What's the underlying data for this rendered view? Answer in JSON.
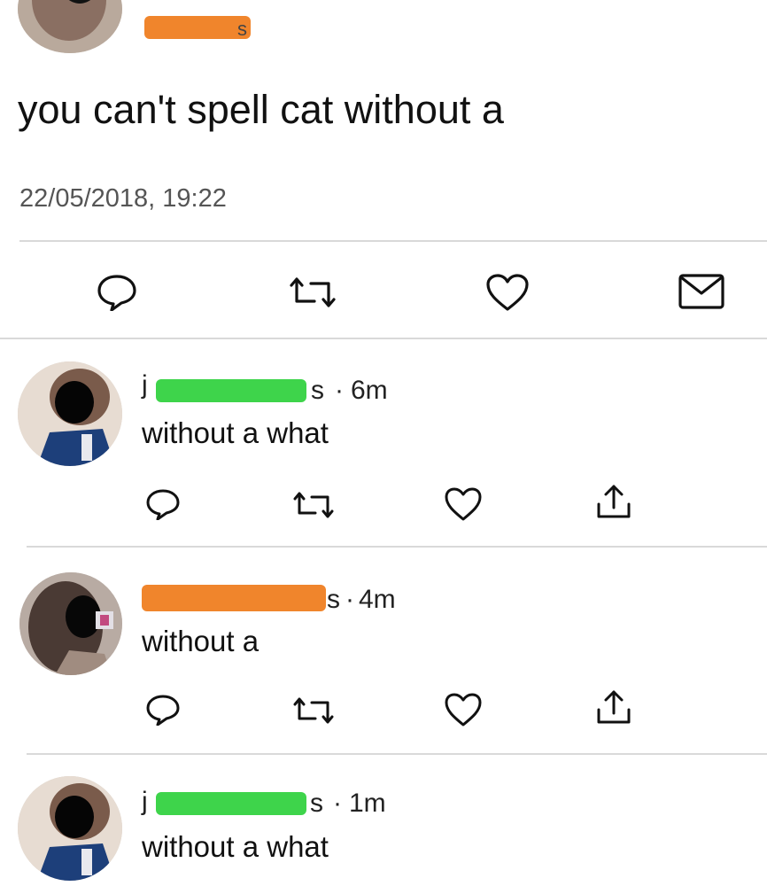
{
  "main_tweet": {
    "text": "you can't spell cat without a",
    "timestamp": "22/05/2018, 19:22",
    "handle_suffix": "s"
  },
  "action_icons": {
    "main": [
      "reply-icon",
      "retweet-icon",
      "like-icon",
      "direct-message-icon"
    ],
    "reply": [
      "reply-icon",
      "retweet-icon",
      "like-icon",
      "share-icon"
    ]
  },
  "replies": [
    {
      "name_prefix": "j",
      "name_suffix": "s",
      "separator": "·",
      "time": "6m",
      "text": "without a what",
      "redaction_color": "#3ed44b"
    },
    {
      "name_suffix": "s",
      "separator": "·",
      "time": "4m",
      "text": "without a",
      "redaction_color": "#f0852c"
    },
    {
      "name_prefix": "j",
      "name_suffix": "s",
      "separator": "·",
      "time": "1m",
      "text": "without a what",
      "redaction_color": "#3ed44b"
    }
  ],
  "colors": {
    "orange_redaction": "#f0852c",
    "green_redaction": "#3ed44b",
    "divider": "#d9d9d9",
    "text": "#1a1a1a"
  }
}
